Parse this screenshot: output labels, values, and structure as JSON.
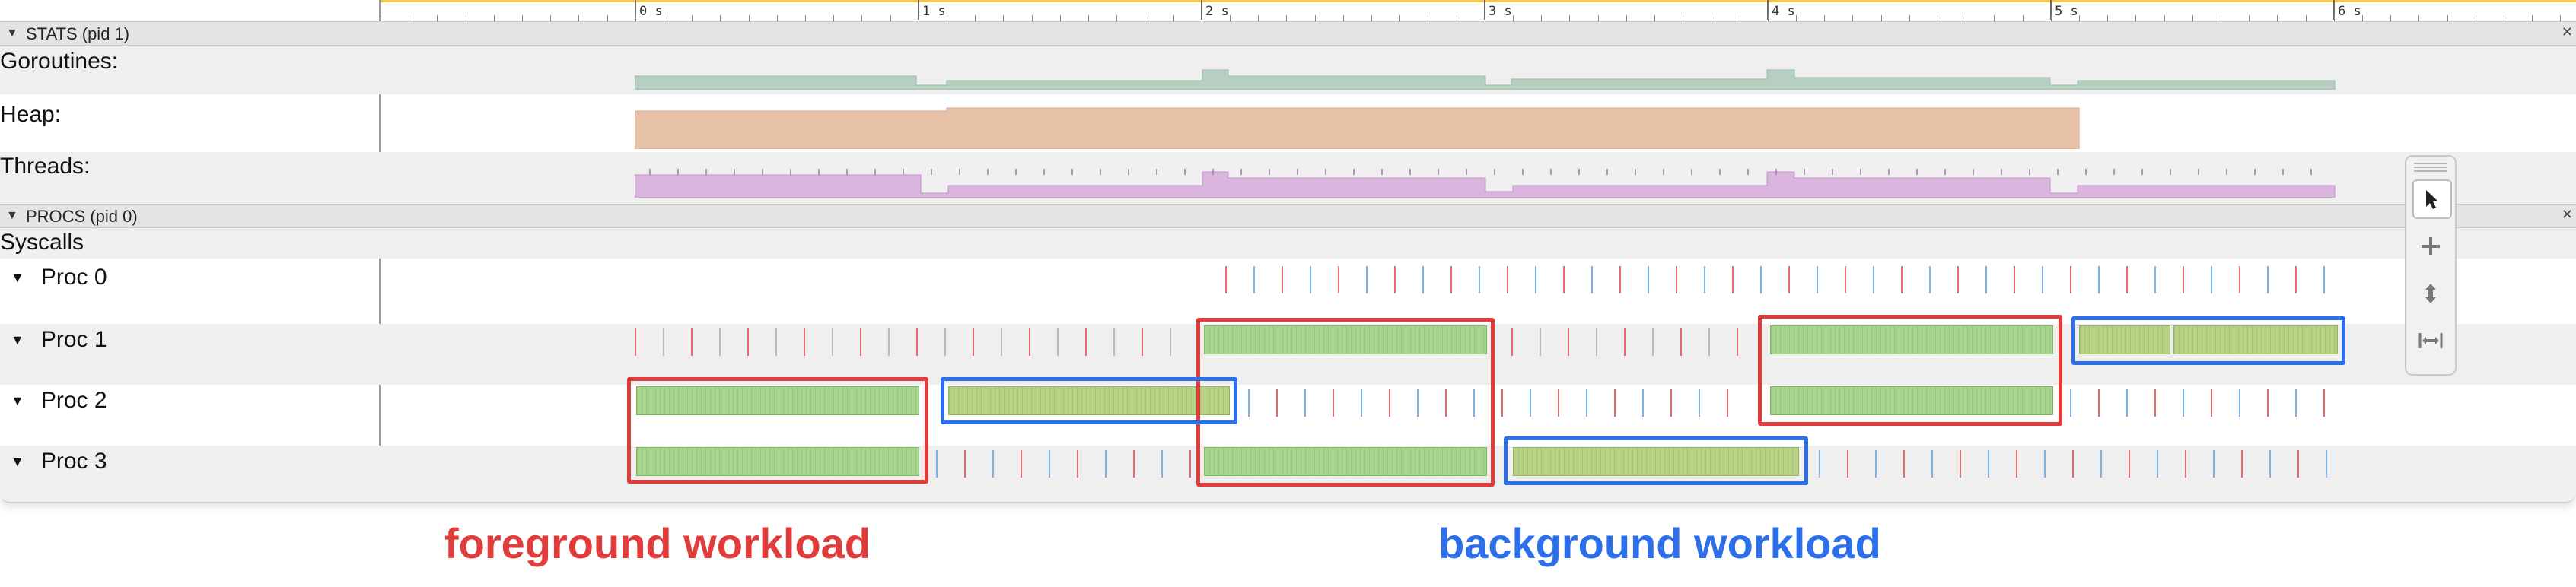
{
  "timeline": {
    "tick_labels": [
      "0 s",
      "1 s",
      "2 s",
      "3 s",
      "4 s",
      "5 s",
      "6 s"
    ]
  },
  "sections": {
    "stats_title": "STATS (pid 1)",
    "procs_title": "PROCS (pid 0)",
    "collapse_glyph": "▼",
    "end_glyph": "✕"
  },
  "stats_rows": {
    "goroutines_label": "Goroutines:",
    "heap_label": "Heap:",
    "threads_label": "Threads:"
  },
  "procs": {
    "syscalls_label": "Syscalls",
    "proc_labels": [
      "Proc 0",
      "Proc 1",
      "Proc 2",
      "Proc 3"
    ]
  },
  "toolbar": {
    "tools": [
      "select-pointer",
      "pan-move",
      "zoom",
      "timing"
    ]
  },
  "annotations": {
    "foreground_label": "foreground workload",
    "background_label": "background workload",
    "foreground_color": "#e03c3c",
    "background_color": "#2d6fe8"
  },
  "colors": {
    "goroutines_fill": "#b7cfc0",
    "heap_fill": "#e8c2a8",
    "threads_fill": "#d9b5de",
    "slice_fill": "#a8d68f",
    "section_header_bg": "#e4e4e4"
  }
}
